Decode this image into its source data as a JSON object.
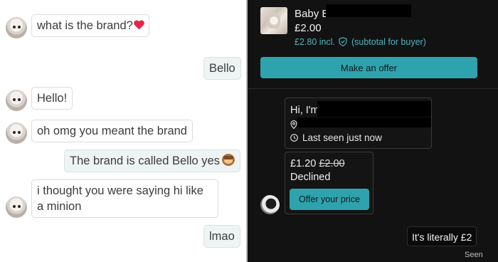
{
  "left_chat": {
    "messages": [
      {
        "sender": "them",
        "text": "what is the brand?",
        "emoji": "heart-icon"
      },
      {
        "sender": "me",
        "text": "Bello"
      },
      {
        "sender": "them",
        "text": "Hello!"
      },
      {
        "sender": "them",
        "text": "oh omg you meant the brand"
      },
      {
        "sender": "me",
        "text": "The brand is called Bello yes",
        "emoji": "monkey-icon"
      },
      {
        "sender": "them",
        "text": "i thought you were saying hi like a minion"
      },
      {
        "sender": "me",
        "text": "lmao"
      }
    ]
  },
  "right_chat": {
    "item": {
      "title": "Baby B",
      "price": "£2.00",
      "incl_price": "£2.80 incl.",
      "incl_note": "(subtotal for buyer)"
    },
    "make_offer_label": "Make an offer",
    "profile": {
      "greeting": "Hi, I'm",
      "last_seen": "Last seen just now"
    },
    "offer": {
      "offered_price": "£1.20",
      "original_price": "£2.00",
      "status": "Declined",
      "button_label": "Offer your price"
    },
    "my_message": "It's literally £2",
    "seen_label": "Seen"
  },
  "colors": {
    "accent": "#2fa3ad",
    "link": "#4fb3bf",
    "dark_bg": "#121212",
    "heart": "#e8264c"
  }
}
